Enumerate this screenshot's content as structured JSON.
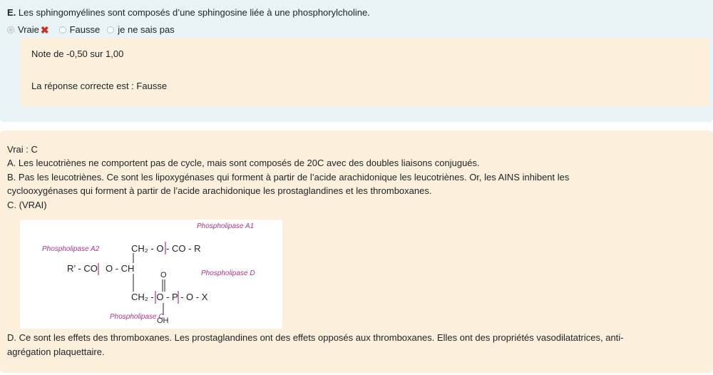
{
  "question": {
    "letter": "E.",
    "text": "Les sphingomyélines sont composés d’une sphingosine liée à une phosphorylcholine.",
    "options": [
      {
        "label": "Vraie",
        "selected": true,
        "incorrect_mark": "✖"
      },
      {
        "label": "Fausse",
        "selected": false
      },
      {
        "label": "je ne sais pas",
        "selected": false
      }
    ]
  },
  "feedback": {
    "grade": "Note de -0,50 sur 1,00",
    "correct_answer": "La réponse correcte est : Fausse"
  },
  "general_feedback": {
    "lines": [
      "Vrai : C",
      "A. Les leucotriènes ne comportent pas de cycle, mais sont composés de 20C avec des doubles liaisons conjugués.",
      "B. Pas les leucotriènes. Ce sont les lipoxygénases qui forment à partir de l’acide arachidonique les leucotriènes. Or, les AINS inhibent les",
      "cyclooxygénases qui forment à partir de l’acide arachidonique les prostaglandines et les thromboxanes.",
      "C. (VRAI)"
    ],
    "diagram": {
      "labels": {
        "pla1": "Phospholipase A1",
        "pla2": "Phospholipase A2",
        "pld": "Phospholipase D",
        "plc": "Phospholipase C"
      },
      "formula": {
        "row1": "CH₂ - O - CO - R",
        "row2_left": "R’ - CO",
        "row2_right": "O - CH",
        "row3": "CH₂ - O - P - O - X",
        "o_top": "O",
        "oh": "OH"
      },
      "label_color": "#b0338a"
    },
    "after_lines": [
      "D. Ce sont les effets des thromboxanes. Les prostaglandines ont des effets opposés aux thromboxanes. Elles ont des propriétés vasodilatatrices, anti-",
      "agrégation plaquettaire."
    ]
  },
  "colors": {
    "question_bg": "#e7f3f5",
    "feedback_bg": "#fcefdc",
    "incorrect": "#ca3120"
  }
}
